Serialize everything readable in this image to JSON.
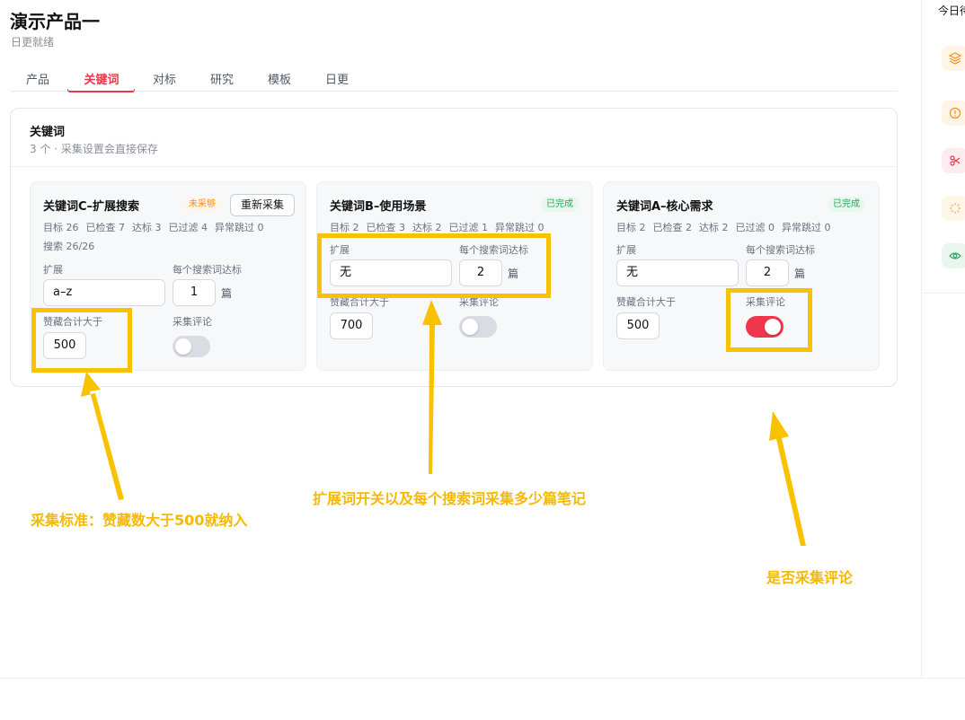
{
  "header": {
    "title": "演示产品一",
    "subtitle": "日更就绪"
  },
  "tabs": [
    {
      "label": "产品",
      "active": false
    },
    {
      "label": "关键词",
      "active": true
    },
    {
      "label": "对标",
      "active": false
    },
    {
      "label": "研究",
      "active": false
    },
    {
      "label": "模板",
      "active": false
    },
    {
      "label": "日更",
      "active": false
    }
  ],
  "section": {
    "title": "关键词",
    "subtitle": "3 个 · 采集设置会直接保存"
  },
  "cards": [
    {
      "title": "关键词C–扩展搜索",
      "badge": "未采够",
      "button": "重新采集",
      "stats": [
        "目标 26",
        "已检查 7",
        "达标 3",
        "已过滤 4",
        "异常跳过 0"
      ],
      "stats2": "搜索 26/26",
      "expand_label": "扩展",
      "expand_value": "a–z",
      "per_label": "每个搜索词达标",
      "per_value": "1",
      "unit": "篇",
      "likes_label": "赞藏合计大于",
      "likes_value": "500",
      "comments_label": "采集评论",
      "comments_on": false
    },
    {
      "title": "关键词B–使用场景",
      "badge": "已完成",
      "stats": [
        "目标 2",
        "已检查 3",
        "达标 2",
        "已过滤 1",
        "异常跳过 0"
      ],
      "expand_label": "扩展",
      "expand_value": "无",
      "per_label": "每个搜索词达标",
      "per_value": "2",
      "unit": "篇",
      "likes_label": "赞藏合计大于",
      "likes_value": "700",
      "comments_label": "采集评论",
      "comments_on": false
    },
    {
      "title": "关键词A–核心需求",
      "badge": "已完成",
      "stats": [
        "目标 2",
        "已检查 2",
        "达标 2",
        "已过滤 0",
        "异常跳过 0"
      ],
      "expand_label": "扩展",
      "expand_value": "无",
      "per_label": "每个搜索词达标",
      "per_value": "2",
      "unit": "篇",
      "likes_label": "赞藏合计大于",
      "likes_value": "500",
      "comments_label": "采集评论",
      "comments_on": true
    }
  ],
  "annotations": {
    "likes": "采集标准：赞藏数大于500就纳入",
    "expand": "扩展词开关以及每个搜索词采集多少篇笔记",
    "comments": "是否采集评论",
    "color": "#f8c200"
  },
  "right_panel": {
    "title": "今日待办",
    "icons": [
      "layers-icon",
      "alert-icon",
      "scissors-icon",
      "loader-icon",
      "eye-icon"
    ]
  },
  "colors": {
    "accent": "#e8364a",
    "toggle_on": "#f0364d",
    "highlight": "#f8c200"
  }
}
